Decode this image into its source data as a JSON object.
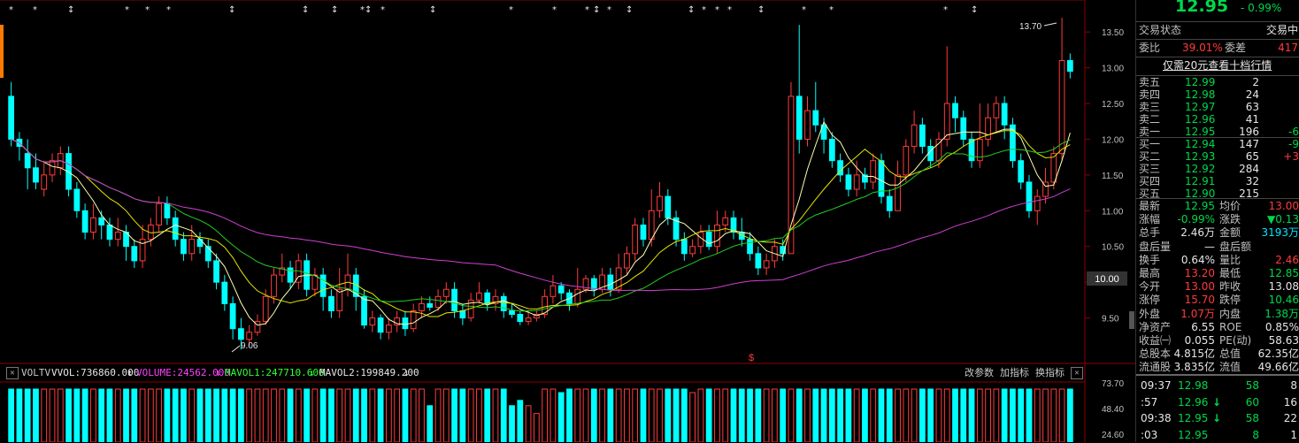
{
  "price_axis": [
    "13.50",
    "13.00",
    "12.50",
    "12.00",
    "11.50",
    "11.00",
    "10.50",
    "10.00",
    "9.50"
  ],
  "current_price_tag": "10.00",
  "high_label": "13.70",
  "low_label": "9.06",
  "dollar_marker": "$",
  "volume_axis": [
    "73.70",
    "48.40",
    "24.60"
  ],
  "indicator_bar": {
    "close_box": "✕",
    "name": "VOLTV",
    "vvol": "VVOL:736860.000",
    "volume": "VOLUME:24562.000",
    "mavol1": "MAVOL1:247710.600",
    "mavol2": "MAVOL2:199849.200",
    "arrow_down": "↓",
    "btn_params": "改参数",
    "btn_add": "加指标",
    "btn_switch": "换指标",
    "btn_close": "✕"
  },
  "colors": {
    "up": "#ff3b3b",
    "down": "#00ffff",
    "ma_white": "#ffffb0",
    "ma_yellow": "#e6e600",
    "ma_green": "#22cc22",
    "ma_magenta": "#d040d0"
  },
  "quote": {
    "top_price": "12.95",
    "top_pct": "- 0.99%",
    "status_label": "交易状态",
    "status_value": "交易中",
    "ratio_label": "委比",
    "ratio_value": "39.01%",
    "diff_label": "委差",
    "diff_value": "417",
    "link": "仅需20元查看十档行情",
    "asks": [
      {
        "label": "卖五",
        "price": "12.99",
        "vol": "2",
        "chg": ""
      },
      {
        "label": "卖四",
        "price": "12.98",
        "vol": "24",
        "chg": ""
      },
      {
        "label": "卖三",
        "price": "12.97",
        "vol": "63",
        "chg": ""
      },
      {
        "label": "卖二",
        "price": "12.96",
        "vol": "41",
        "chg": ""
      },
      {
        "label": "卖一",
        "price": "12.95",
        "vol": "196",
        "chg": "-6"
      }
    ],
    "bids": [
      {
        "label": "买一",
        "price": "12.94",
        "vol": "147",
        "chg": "-9"
      },
      {
        "label": "买二",
        "price": "12.93",
        "vol": "65",
        "chg": "+3"
      },
      {
        "label": "买三",
        "price": "12.92",
        "vol": "284",
        "chg": ""
      },
      {
        "label": "买四",
        "price": "12.91",
        "vol": "32",
        "chg": ""
      },
      {
        "label": "买五",
        "price": "12.90",
        "vol": "215",
        "chg": ""
      }
    ],
    "stats": [
      {
        "l1": "最新",
        "v1": "12.95",
        "c1": "green",
        "l2": "均价",
        "v2": "13.00",
        "c2": "red"
      },
      {
        "l1": "涨幅",
        "v1": "-0.99%",
        "c1": "green",
        "l2": "涨跌",
        "v2": "▼0.13",
        "c2": "green"
      },
      {
        "l1": "总手",
        "v1": "2.46万",
        "c1": "white",
        "l2": "金额",
        "v2": "3193万",
        "c2": "cyan"
      },
      {
        "l1": "盘后量",
        "v1": "—",
        "c1": "white",
        "l2": "盘后额",
        "v2": "",
        "c2": "white"
      },
      {
        "l1": "换手",
        "v1": "0.64%",
        "c1": "white",
        "l2": "量比",
        "v2": "2.46",
        "c2": "red"
      },
      {
        "l1": "最高",
        "v1": "13.20",
        "c1": "red",
        "l2": "最低",
        "v2": "12.85",
        "c2": "green"
      },
      {
        "l1": "今开",
        "v1": "13.00",
        "c1": "red",
        "l2": "昨收",
        "v2": "13.08",
        "c2": "white"
      },
      {
        "l1": "涨停",
        "v1": "15.70",
        "c1": "red",
        "l2": "跌停",
        "v2": "10.46",
        "c2": "green"
      },
      {
        "l1": "外盘",
        "v1": "1.07万",
        "c1": "red",
        "l2": "内盘",
        "v2": "1.38万",
        "c2": "green"
      },
      {
        "l1": "净资产",
        "v1": "6.55",
        "c1": "white",
        "l2": "ROE",
        "v2": "0.85%",
        "c2": "white"
      },
      {
        "l1": "收益㈠",
        "v1": "0.055",
        "c1": "white",
        "l2": "PE(动)",
        "v2": "58.63",
        "c2": "white"
      },
      {
        "l1": "总股本",
        "v1": "4.815亿",
        "c1": "white",
        "l2": "总值",
        "v2": "62.35亿",
        "c2": "white"
      },
      {
        "l1": "流通股",
        "v1": "3.835亿",
        "c1": "white",
        "l2": "流值",
        "v2": "49.66亿",
        "c2": "white"
      }
    ],
    "ticks": [
      {
        "time": "09:37",
        "price": "12.98",
        "arrow": "",
        "vol": "58",
        "n": "8"
      },
      {
        "time": ":57",
        "price": "12.96",
        "arrow": "↓",
        "vol": "60",
        "n": "16"
      },
      {
        "time": "09:38",
        "price": "12.95",
        "arrow": "↓",
        "vol": "58",
        "n": "22"
      },
      {
        "time": ":03",
        "price": "12.95",
        "arrow": "",
        "vol": "8",
        "n": "1"
      }
    ]
  },
  "chart_data": {
    "type": "candlestick",
    "ylim": [
      9.0,
      13.7
    ],
    "high": 13.7,
    "low": 9.06,
    "candles": [
      [
        12.6,
        12.0,
        12.8,
        11.9
      ],
      [
        12.0,
        11.9,
        12.1,
        11.7
      ],
      [
        11.8,
        11.6,
        12.0,
        11.3
      ],
      [
        11.6,
        11.4,
        11.8,
        11.3
      ],
      [
        11.3,
        11.5,
        11.7,
        11.2
      ],
      [
        11.5,
        11.7,
        11.8,
        11.4
      ],
      [
        11.6,
        11.8,
        11.9,
        11.5
      ],
      [
        11.8,
        11.3,
        11.9,
        11.2
      ],
      [
        11.3,
        11.0,
        11.4,
        10.9
      ],
      [
        11.0,
        10.7,
        11.1,
        10.6
      ],
      [
        10.7,
        10.9,
        11.1,
        10.6
      ],
      [
        10.9,
        10.8,
        11.0,
        10.6
      ],
      [
        10.8,
        10.6,
        10.9,
        10.5
      ],
      [
        10.6,
        10.7,
        10.9,
        10.5
      ],
      [
        10.7,
        10.5,
        10.8,
        10.3
      ],
      [
        10.5,
        10.3,
        10.6,
        10.2
      ],
      [
        10.3,
        10.6,
        10.8,
        10.2
      ],
      [
        10.6,
        10.8,
        10.9,
        10.5
      ],
      [
        10.8,
        11.1,
        11.2,
        10.7
      ],
      [
        11.1,
        10.9,
        11.2,
        10.8
      ],
      [
        10.9,
        10.6,
        11.0,
        10.5
      ],
      [
        10.6,
        10.4,
        10.7,
        10.3
      ],
      [
        10.4,
        10.6,
        10.8,
        10.3
      ],
      [
        10.6,
        10.5,
        10.7,
        10.4
      ],
      [
        10.5,
        10.3,
        10.6,
        10.2
      ],
      [
        10.3,
        10.0,
        10.4,
        9.9
      ],
      [
        10.0,
        9.7,
        10.1,
        9.6
      ],
      [
        9.7,
        9.35,
        9.8,
        9.2
      ],
      [
        9.35,
        9.2,
        9.5,
        9.06
      ],
      [
        9.2,
        9.3,
        9.4,
        9.1
      ],
      [
        9.3,
        9.45,
        9.55,
        9.25
      ],
      [
        9.45,
        9.8,
        9.9,
        9.4
      ],
      [
        9.8,
        10.1,
        10.2,
        9.7
      ],
      [
        10.1,
        10.2,
        10.4,
        10.0
      ],
      [
        10.2,
        10.0,
        10.3,
        9.9
      ],
      [
        10.0,
        10.3,
        10.4,
        9.9
      ],
      [
        10.3,
        9.9,
        10.4,
        9.8
      ],
      [
        9.9,
        10.1,
        10.2,
        9.8
      ],
      [
        10.1,
        9.8,
        10.2,
        9.6
      ],
      [
        9.8,
        9.6,
        9.9,
        9.5
      ],
      [
        9.6,
        9.9,
        10.2,
        9.5
      ],
      [
        9.9,
        10.1,
        10.4,
        9.8
      ],
      [
        10.1,
        9.8,
        10.2,
        9.6
      ],
      [
        9.8,
        9.4,
        9.9,
        9.35
      ],
      [
        9.4,
        9.5,
        9.6,
        9.3
      ],
      [
        9.5,
        9.3,
        9.55,
        9.2
      ],
      [
        9.3,
        9.4,
        9.5,
        9.2
      ],
      [
        9.4,
        9.5,
        9.6,
        9.3
      ],
      [
        9.5,
        9.35,
        9.6,
        9.25
      ],
      [
        9.35,
        9.6,
        9.7,
        9.3
      ],
      [
        9.6,
        9.7,
        9.8,
        9.5
      ],
      [
        9.7,
        9.65,
        9.8,
        9.6
      ],
      [
        9.65,
        9.8,
        9.9,
        9.6
      ],
      [
        9.8,
        9.9,
        10.0,
        9.7
      ],
      [
        9.9,
        9.6,
        10.0,
        9.5
      ],
      [
        9.6,
        9.5,
        9.7,
        9.4
      ],
      [
        9.5,
        9.75,
        9.85,
        9.45
      ],
      [
        9.75,
        9.85,
        10.0,
        9.7
      ],
      [
        9.85,
        9.7,
        9.9,
        9.6
      ],
      [
        9.7,
        9.8,
        9.9,
        9.6
      ],
      [
        9.8,
        9.6,
        9.85,
        9.5
      ],
      [
        9.6,
        9.55,
        9.7,
        9.5
      ],
      [
        9.55,
        9.45,
        9.6,
        9.4
      ],
      [
        9.45,
        9.5,
        9.6,
        9.4
      ],
      [
        9.5,
        9.55,
        9.6,
        9.45
      ],
      [
        9.55,
        9.8,
        9.9,
        9.5
      ],
      [
        9.8,
        9.95,
        10.1,
        9.7
      ],
      [
        9.95,
        9.85,
        10.0,
        9.75
      ],
      [
        9.85,
        9.7,
        9.9,
        9.6
      ],
      [
        9.7,
        9.9,
        10.2,
        9.65
      ],
      [
        9.9,
        10.05,
        10.1,
        9.85
      ],
      [
        10.05,
        9.9,
        10.1,
        9.8
      ],
      [
        9.9,
        10.1,
        10.2,
        9.85
      ],
      [
        10.1,
        9.9,
        10.2,
        9.8
      ],
      [
        9.9,
        10.2,
        10.4,
        9.85
      ],
      [
        10.2,
        10.4,
        10.5,
        10.1
      ],
      [
        10.4,
        10.8,
        10.9,
        10.3
      ],
      [
        10.8,
        10.6,
        10.9,
        10.5
      ],
      [
        10.6,
        11.0,
        11.3,
        10.5
      ],
      [
        11.0,
        11.2,
        11.4,
        10.9
      ],
      [
        11.2,
        10.9,
        11.3,
        10.8
      ],
      [
        10.9,
        10.6,
        11.0,
        10.5
      ],
      [
        10.6,
        10.4,
        10.7,
        10.3
      ],
      [
        10.4,
        10.5,
        10.6,
        10.35
      ],
      [
        10.5,
        10.7,
        10.8,
        10.4
      ],
      [
        10.7,
        10.5,
        10.8,
        10.45
      ],
      [
        10.5,
        10.8,
        11.0,
        10.4
      ],
      [
        10.8,
        10.9,
        11.0,
        10.7
      ],
      [
        10.9,
        10.7,
        11.0,
        10.6
      ],
      [
        10.7,
        10.6,
        10.9,
        10.5
      ],
      [
        10.6,
        10.4,
        10.7,
        10.3
      ],
      [
        10.4,
        10.2,
        10.5,
        10.1
      ],
      [
        10.2,
        10.3,
        10.4,
        10.1
      ],
      [
        10.3,
        10.5,
        10.6,
        10.2
      ],
      [
        10.5,
        10.4,
        10.6,
        10.3
      ],
      [
        10.4,
        12.6,
        12.8,
        10.4
      ],
      [
        12.6,
        12.0,
        13.6,
        11.8
      ],
      [
        12.0,
        12.4,
        12.6,
        11.9
      ],
      [
        12.4,
        12.2,
        12.8,
        12.1
      ],
      [
        12.2,
        12.0,
        12.3,
        11.8
      ],
      [
        12.0,
        11.7,
        12.1,
        11.6
      ],
      [
        11.7,
        11.5,
        11.8,
        11.4
      ],
      [
        11.5,
        11.3,
        11.6,
        11.2
      ],
      [
        11.3,
        11.5,
        11.7,
        11.2
      ],
      [
        11.5,
        11.4,
        11.6,
        11.3
      ],
      [
        11.4,
        11.7,
        11.8,
        11.3
      ],
      [
        11.7,
        11.2,
        11.8,
        11.1
      ],
      [
        11.2,
        11.0,
        11.3,
        10.9
      ],
      [
        11.0,
        11.5,
        11.7,
        11.0
      ],
      [
        11.5,
        11.9,
        12.0,
        11.4
      ],
      [
        11.9,
        12.2,
        12.4,
        11.8
      ],
      [
        12.2,
        11.9,
        12.3,
        11.8
      ],
      [
        11.9,
        11.7,
        12.0,
        11.6
      ],
      [
        11.7,
        12.0,
        12.1,
        11.6
      ],
      [
        12.0,
        12.5,
        13.3,
        11.9
      ],
      [
        12.5,
        12.3,
        12.6,
        12.1
      ],
      [
        12.3,
        12.0,
        12.4,
        11.9
      ],
      [
        12.0,
        11.7,
        12.1,
        11.6
      ],
      [
        11.7,
        12.0,
        12.5,
        11.6
      ],
      [
        12.0,
        12.3,
        12.5,
        11.9
      ],
      [
        12.3,
        12.5,
        12.6,
        12.1
      ],
      [
        12.5,
        12.2,
        12.6,
        12.0
      ],
      [
        12.2,
        11.7,
        12.3,
        11.6
      ],
      [
        11.7,
        11.4,
        11.8,
        11.3
      ],
      [
        11.4,
        11.0,
        11.5,
        10.9
      ],
      [
        11.0,
        11.2,
        11.3,
        10.8
      ],
      [
        11.2,
        11.4,
        11.6,
        11.1
      ],
      [
        11.4,
        11.8,
        11.9,
        11.3
      ],
      [
        11.8,
        13.1,
        13.7,
        11.7
      ],
      [
        13.1,
        12.95,
        13.2,
        12.85
      ]
    ]
  }
}
